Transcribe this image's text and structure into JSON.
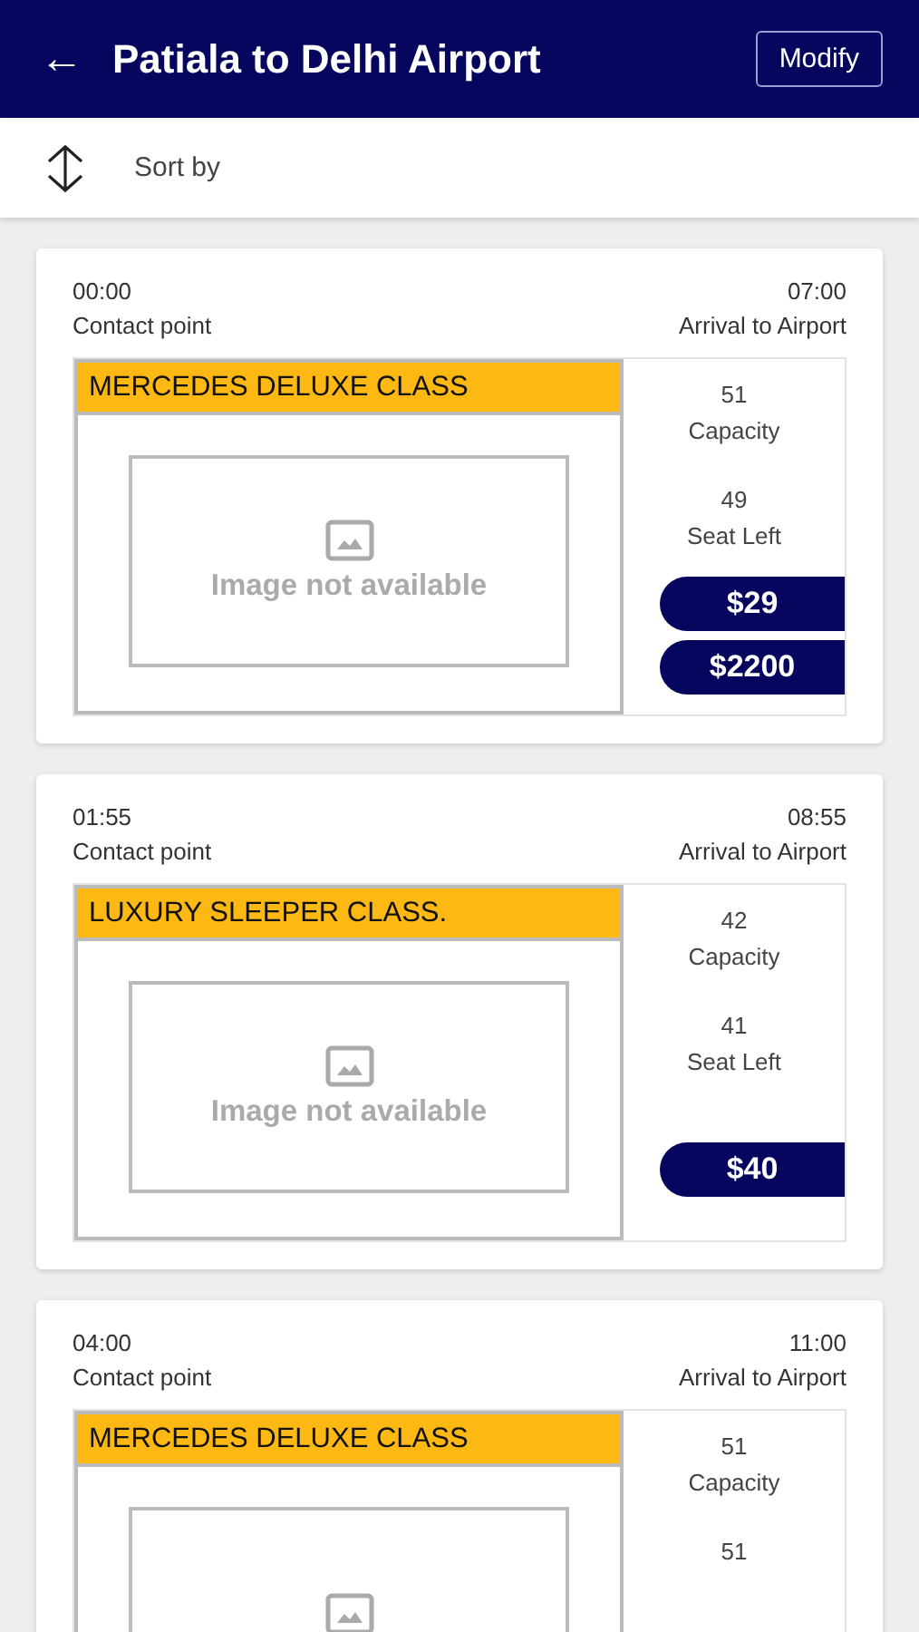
{
  "header": {
    "back_icon": "←",
    "title": "Patiala to Delhi Airport",
    "modify_button": "Modify"
  },
  "sort": {
    "label": "Sort by"
  },
  "trips": [
    {
      "departure_time": "00:00",
      "departure_label": "Contact point",
      "arrival_time": "07:00",
      "arrival_label": "Arrival to Airport",
      "bus_class": "MERCEDES DELUXE CLASS",
      "image_text": "Image not available",
      "capacity": "51",
      "capacity_label": "Capacity",
      "seats_left": "49",
      "seats_left_label": "Seat Left",
      "prices": [
        "$29",
        "$2200"
      ]
    },
    {
      "departure_time": "01:55",
      "departure_label": "Contact point",
      "arrival_time": "08:55",
      "arrival_label": "Arrival to Airport",
      "bus_class": "LUXURY SLEEPER CLASS.",
      "image_text": "Image not available",
      "capacity": "42",
      "capacity_label": "Capacity",
      "seats_left": "41",
      "seats_left_label": "Seat Left",
      "prices": [
        "$40"
      ]
    },
    {
      "departure_time": "04:00",
      "departure_label": "Contact point",
      "arrival_time": "11:00",
      "arrival_label": "Arrival to Airport",
      "bus_class": "MERCEDES DELUXE CLASS",
      "capacity": "51",
      "capacity_label": "Capacity",
      "seats_left": "51"
    }
  ]
}
